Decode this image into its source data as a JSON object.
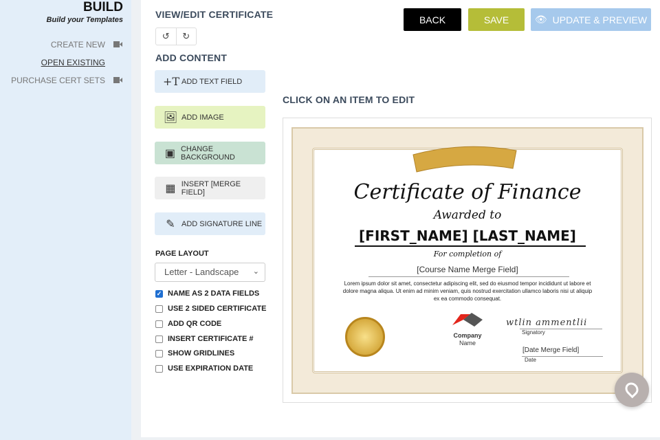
{
  "sidebar": {
    "title": "BUILD",
    "subtitle": "Build your Templates",
    "items": [
      {
        "label": "CREATE NEW"
      },
      {
        "label": "OPEN EXISTING"
      },
      {
        "label": "PURCHASE CERT SETS"
      }
    ]
  },
  "header": {
    "title": "VIEW/EDIT CERTIFICATE",
    "back": "BACK",
    "save": "SAVE",
    "update": "UPDATE & PREVIEW"
  },
  "add_content": {
    "title": "ADD CONTENT",
    "buttons": [
      {
        "label": "ADD TEXT FIELD"
      },
      {
        "label": "ADD IMAGE"
      },
      {
        "label": "CHANGE BACKGROUND"
      },
      {
        "label": "INSERT [MERGE FIELD]"
      },
      {
        "label": "ADD SIGNATURE LINE"
      }
    ]
  },
  "page_layout": {
    "label": "PAGE LAYOUT",
    "selected": "Letter - Landscape"
  },
  "options": [
    {
      "label": "NAME AS 2 DATA FIELDS",
      "checked": true
    },
    {
      "label": "USE 2 SIDED CERTIFICATE",
      "checked": false
    },
    {
      "label": "ADD QR CODE",
      "checked": false
    },
    {
      "label": "INSERT CERTIFICATE #",
      "checked": false
    },
    {
      "label": "SHOW GRIDLINES",
      "checked": false
    },
    {
      "label": "USE EXPIRATION DATE",
      "checked": false
    }
  ],
  "canvas": {
    "hint": "CLICK ON AN ITEM TO EDIT"
  },
  "certificate": {
    "title": "Certificate of Finance",
    "awarded": "Awarded to",
    "name": "[FIRST_NAME] [LAST_NAME]",
    "for": "For completion of",
    "course": "[Course Name Merge Field]",
    "body": "Lorem ipsum dolor sit amet, consectetur adipiscing elit, sed do eiusmod tempor incididunt ut labore et dolore magna aliqua. Ut enim ad minim veniam, quis nostrud exercitation ullamco laboris nisi ut aliquip ex ea commodo consequat.",
    "company": "Company",
    "company2": "Name",
    "signatory": "Signatory",
    "date_field": "[Date Merge Field]",
    "date": "Date"
  },
  "colors": {
    "back": "#000000",
    "save": "#b5bd38",
    "update": "#a6c9ec"
  }
}
